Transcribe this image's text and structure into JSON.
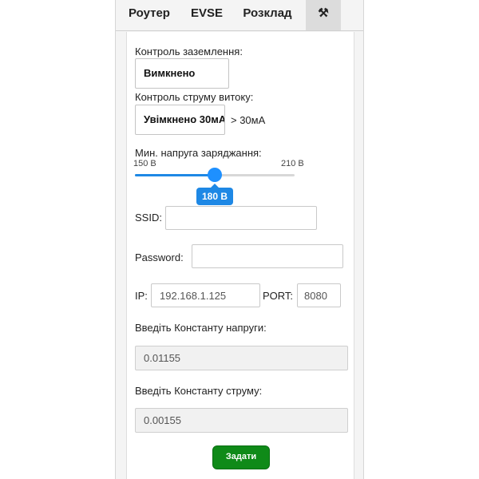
{
  "tabs": [
    {
      "label": "Роутер"
    },
    {
      "label": "EVSE"
    },
    {
      "label": "Розклад"
    },
    {
      "label": "⚒"
    }
  ],
  "ground_control": {
    "label": "Контроль заземлення:",
    "value": "Вимкнено"
  },
  "leakage_control": {
    "label": "Контроль струму витоку:",
    "value": "Увімкнено 30мА",
    "note": "> 30мА"
  },
  "min_voltage": {
    "label": "Мин. напруга заряджання:",
    "min_label": "150 В",
    "max_label": "210 В",
    "value_label": "180 В",
    "fraction": 0.5
  },
  "ssid": {
    "label": "SSID:",
    "value": ""
  },
  "password": {
    "label": "Password:",
    "value": ""
  },
  "ip": {
    "label": "IP:",
    "value": "192.168.1.125"
  },
  "port": {
    "label": "PORT:",
    "value": "8080"
  },
  "voltage_const": {
    "label": "Введіть Константу напруги:",
    "value": "0.01155"
  },
  "current_const": {
    "label": "Введіть Константу струму:",
    "value": "0.00155"
  },
  "submit_label": "Задати",
  "colors": {
    "accent": "#1e88e5",
    "submit": "#0f8a18",
    "tab_active": "#dcdcdc"
  }
}
